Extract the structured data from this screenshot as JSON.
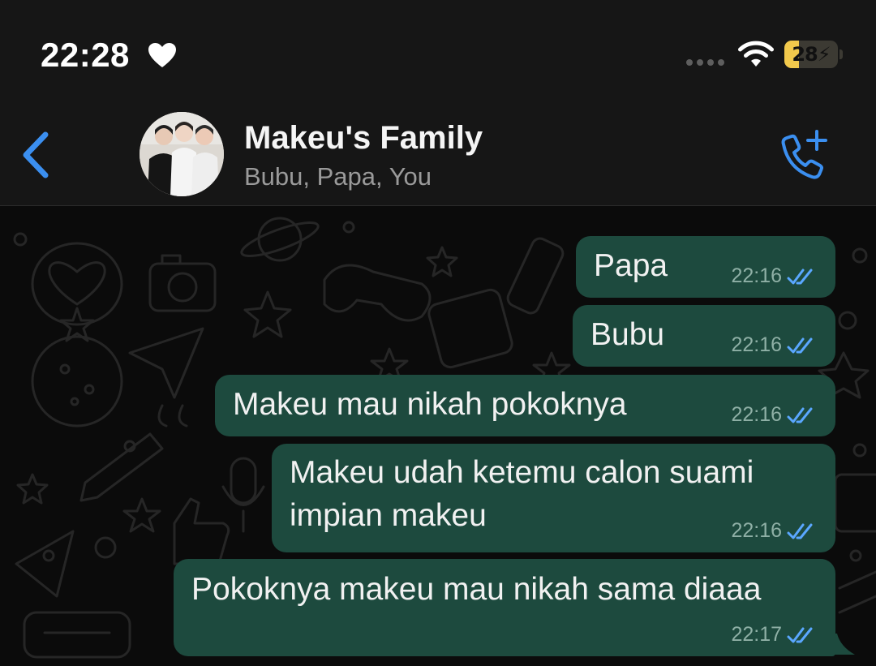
{
  "status_bar": {
    "time": "22:28",
    "battery": "28",
    "battery_level": 0.28
  },
  "header": {
    "group_name": "Makeu's Family",
    "members": "Bubu, Papa, You"
  },
  "icons": {
    "heart": "heart-icon",
    "wifi": "wifi-icon",
    "back": "chevron-left-icon",
    "add_call": "phone-plus-icon",
    "read_receipt": "double-check-icon"
  },
  "colors": {
    "accent": "#3b8ff0",
    "bubble": "#1d4a3e",
    "read_check": "#5aa7ff"
  },
  "messages": [
    {
      "lines": [
        "Papa"
      ],
      "time": "22:16"
    },
    {
      "lines": [
        "Bubu"
      ],
      "time": "22:16"
    },
    {
      "lines": [
        "Makeu mau nikah pokoknya"
      ],
      "time": "22:16"
    },
    {
      "lines": [
        "Makeu udah ketemu calon suami",
        "impian makeu"
      ],
      "time": "22:16"
    },
    {
      "lines": [
        "Pokoknya makeu mau nikah sama diaaa"
      ],
      "time": "22:17"
    }
  ]
}
